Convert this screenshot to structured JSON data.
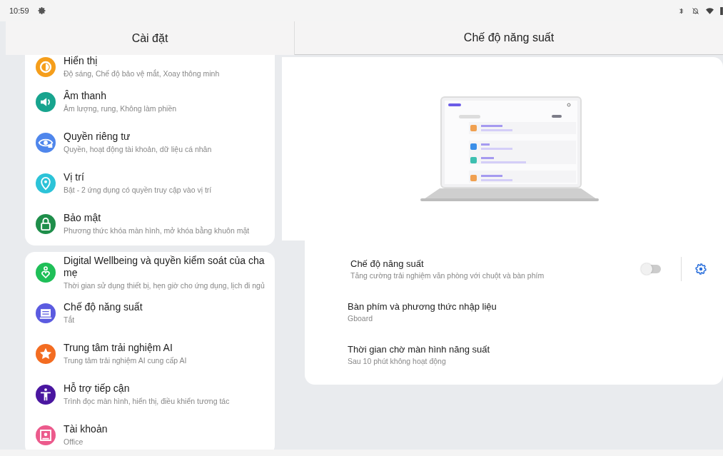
{
  "status_bar": {
    "time": "10:59"
  },
  "settings_pane": {
    "title": "Cài đặt",
    "groups": [
      {
        "items": [
          {
            "title": "Hiển thị",
            "subtitle": "Độ sáng, Chế độ bảo vệ mắt, Xoay thông minh",
            "color": "#f59e1b"
          },
          {
            "title": "Âm thanh",
            "subtitle": "Âm lượng, rung, Không làm phiền",
            "color": "#17a48e"
          },
          {
            "title": "Quyền riêng tư",
            "subtitle": "Quyền, hoạt động tài khoản, dữ liệu cá nhân",
            "color": "#4f86ec"
          },
          {
            "title": "Vị trí",
            "subtitle": "Bật - 2 ứng dụng có quyền truy cập vào vị trí",
            "color": "#2cc3d8"
          },
          {
            "title": "Bảo mật",
            "subtitle": "Phương thức khóa màn hình, mở khóa bằng khuôn mặt",
            "color": "#1e8e4a"
          }
        ]
      },
      {
        "items": [
          {
            "title": "Digital Wellbeing và quyền kiểm soát của cha mẹ",
            "subtitle": "Thời gian sử dụng thiết bị, hẹn giờ cho ứng dụng, lịch đi ngủ",
            "color": "#1fbf58"
          },
          {
            "title": "Chế độ năng suất",
            "subtitle": "Tắt",
            "color": "#5b5be0"
          },
          {
            "title": "Trung tâm trải nghiệm AI",
            "subtitle": "Trung tâm trải nghiệm AI cung cấp AI",
            "color": "#f36c21"
          },
          {
            "title": "Hỗ trợ tiếp cận",
            "subtitle": "Trình đọc màn hình, hiển thị, điều khiển tương tác",
            "color": "#4a16a0"
          },
          {
            "title": "Tài khoản",
            "subtitle": "Office",
            "color": "#ec5a8c"
          }
        ]
      }
    ]
  },
  "detail_pane": {
    "title": "Chế độ năng suất",
    "options": [
      {
        "kind": "toggle",
        "title": "Chế độ năng suất",
        "subtitle": "Tăng cường trải nghiệm văn phòng với chuột và bàn phím",
        "on": false
      },
      {
        "kind": "plain",
        "title": "Bàn phím và phương thức nhập liệu",
        "subtitle": "Gboard"
      },
      {
        "kind": "plain",
        "title": "Thời gian chờ màn hình năng suất",
        "subtitle": "Sau 10 phút không hoạt động"
      }
    ]
  }
}
